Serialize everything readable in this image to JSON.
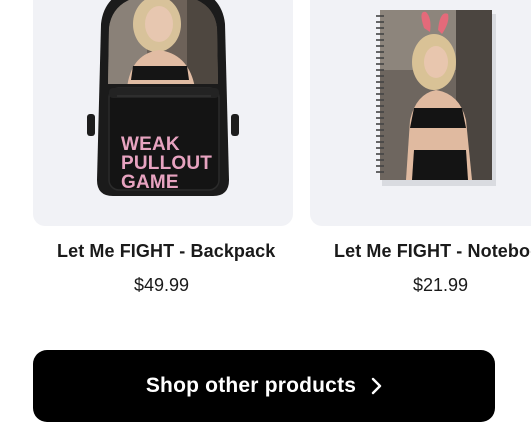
{
  "products": [
    {
      "title": "Let Me FIGHT - Backpack",
      "price": "$49.99",
      "print_lines": [
        "WEAK",
        "PULLOUT",
        "GAME"
      ]
    },
    {
      "title": "Let Me FIGHT - Notebook",
      "price": "$21.99"
    }
  ],
  "shop_button": {
    "label": "Shop other products",
    "icon": "chevron-right-icon"
  },
  "colors": {
    "card_background": "#f1f2f6",
    "button_background": "#000000",
    "button_text": "#ffffff",
    "print_pink": "#e7a3c0"
  }
}
